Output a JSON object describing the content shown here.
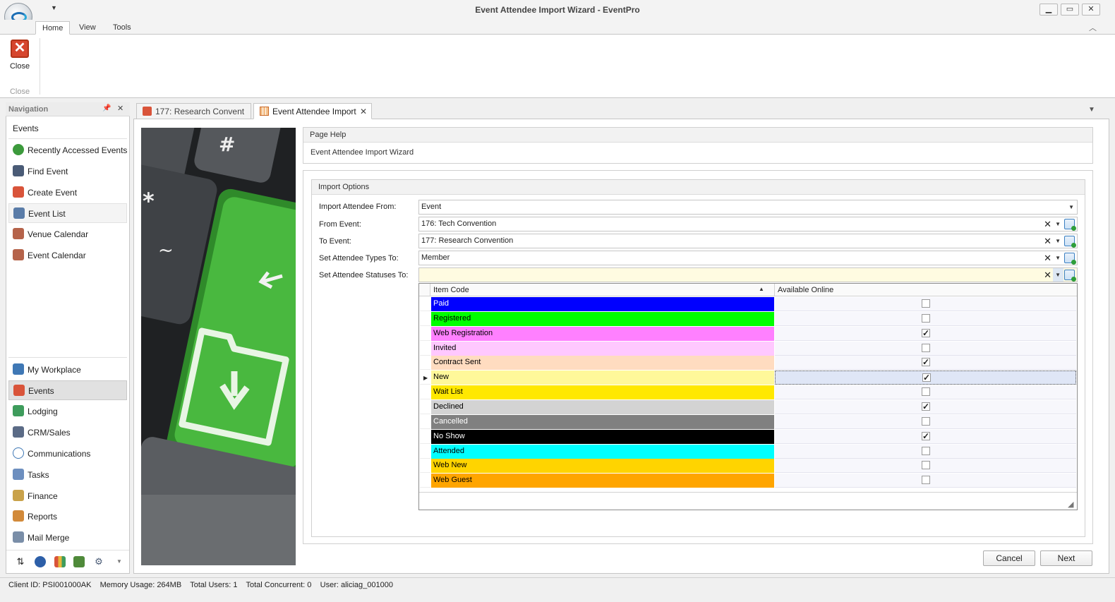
{
  "window": {
    "title": "Event Attendee Import Wizard - EventPro",
    "controls": {
      "minimize": "▁",
      "maximize": "▭",
      "close": "✕"
    }
  },
  "ribbon": {
    "tabs": [
      "Home",
      "View",
      "Tools"
    ],
    "active_tab": "Home",
    "close_button_label": "Close",
    "close_group_label": "Close"
  },
  "navigation": {
    "title": "Navigation",
    "section": "Events",
    "items": [
      {
        "label": "Recently Accessed Events",
        "icon": "clock-icon"
      },
      {
        "label": "Find Event",
        "icon": "binoculars-icon"
      },
      {
        "label": "Create Event",
        "icon": "pushpin-add-icon"
      },
      {
        "label": "Event List",
        "icon": "list-icon"
      },
      {
        "label": "Venue Calendar",
        "icon": "calendar-icon"
      },
      {
        "label": "Event Calendar",
        "icon": "calendar-icon"
      }
    ],
    "modules": [
      {
        "label": "My Workplace",
        "icon": "house-icon"
      },
      {
        "label": "Events",
        "icon": "pushpin-icon"
      },
      {
        "label": "Lodging",
        "icon": "bed-icon"
      },
      {
        "label": "CRM/Sales",
        "icon": "crm-icon"
      },
      {
        "label": "Communications",
        "icon": "speech-bubble-icon"
      },
      {
        "label": "Tasks",
        "icon": "clipboard-check-icon"
      },
      {
        "label": "Finance",
        "icon": "ledger-icon"
      },
      {
        "label": "Reports",
        "icon": "report-icon"
      },
      {
        "label": "Mail Merge",
        "icon": "mail-merge-icon"
      }
    ],
    "bottom_icons": [
      "sort-arrows-icon",
      "globe-icon",
      "bar-chart-icon",
      "line-chart-icon",
      "gear-icon",
      "overflow-arrow-icon"
    ]
  },
  "document_tabs": [
    {
      "label": "177: Research Convent",
      "icon": "pushpin-icon"
    },
    {
      "label": "Event Attendee Import",
      "icon": "grid-icon"
    }
  ],
  "page_help": {
    "title": "Page Help",
    "text": "Event Attendee Import Wizard"
  },
  "import_options": {
    "title": "Import Options",
    "fields": [
      {
        "label": "Import Attendee From:",
        "value": "Event"
      },
      {
        "label": "From Event:",
        "value": "176: Tech Convention"
      },
      {
        "label": "To Event:",
        "value": "177: Research Convention"
      },
      {
        "label": "Set Attendee Types To:",
        "value": "Member"
      },
      {
        "label": "Set Attendee Statuses To:",
        "value": ""
      }
    ]
  },
  "status_grid": {
    "columns": [
      "Item Code",
      "Available Online"
    ],
    "rows": [
      {
        "code": "Paid",
        "online": false,
        "bg": "#0000ff",
        "fg": "#ffffff"
      },
      {
        "code": "Registered",
        "online": false,
        "bg": "#00ff00",
        "fg": "#000000"
      },
      {
        "code": "Web Registration",
        "online": true,
        "bg": "#ff80ff",
        "fg": "#000000"
      },
      {
        "code": "Invited",
        "online": false,
        "bg": "#ffc8ff",
        "fg": "#000000"
      },
      {
        "code": "Contract Sent",
        "online": true,
        "bg": "#ffdcc0",
        "fg": "#000000"
      },
      {
        "code": "New",
        "online": true,
        "bg": "#fff89a",
        "fg": "#000000"
      },
      {
        "code": "Wait List",
        "online": false,
        "bg": "#ffe800",
        "fg": "#000000"
      },
      {
        "code": "Declined",
        "online": true,
        "bg": "#d3d3d3",
        "fg": "#000000"
      },
      {
        "code": "Cancelled",
        "online": false,
        "bg": "#808080",
        "fg": "#ffffff"
      },
      {
        "code": "No Show",
        "online": true,
        "bg": "#000000",
        "fg": "#ffffff"
      },
      {
        "code": "Attended",
        "online": false,
        "bg": "#00ffff",
        "fg": "#000000"
      },
      {
        "code": "Web New",
        "online": false,
        "bg": "#ffd400",
        "fg": "#000000"
      },
      {
        "code": "Web Guest",
        "online": false,
        "bg": "#ffa500",
        "fg": "#000000"
      }
    ]
  },
  "buttons": {
    "cancel": "Cancel",
    "next": "Next"
  },
  "status_bar": "Client ID: PSI001000AK    Memory Usage: 264MB    Total Users: 1    Total Concurrent: 0    User: aliciag_001000"
}
